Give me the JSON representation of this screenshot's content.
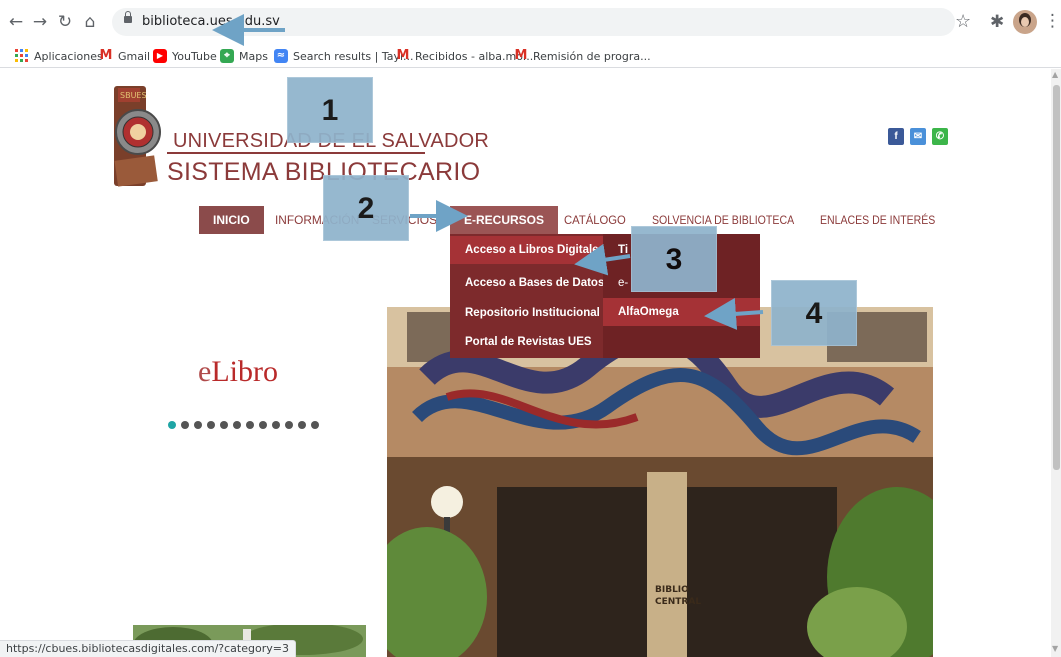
{
  "browser": {
    "url": "biblioteca.ues.edu.sv",
    "bookmarks": [
      {
        "label": "Aplicaciones",
        "icon": "apps-grid-icon"
      },
      {
        "label": "Gmail",
        "icon": "gmail-icon"
      },
      {
        "label": "YouTube",
        "icon": "youtube-icon"
      },
      {
        "label": "Maps",
        "icon": "maps-icon"
      },
      {
        "label": "Search results | Tayl...",
        "icon": "search-results-icon"
      },
      {
        "label": "Recibidos - alba.mo...",
        "icon": "gmail-icon"
      },
      {
        "label": "Remisión de progra...",
        "icon": "gmail-icon"
      }
    ],
    "status_url": "https://cbues.bibliotecasdigitales.com/?category=3"
  },
  "site": {
    "title_line1": "UNIVERSIDAD DE EL SALVADOR",
    "title_line2": "SISTEMA BIBLIOTECARIO",
    "social": [
      {
        "icon": "facebook-icon",
        "glyph": "f",
        "color": "#3b5998"
      },
      {
        "icon": "mail-icon",
        "glyph": "✉",
        "color": "#4a90d9"
      },
      {
        "icon": "phone-icon",
        "glyph": "✆",
        "color": "#3cb54a"
      }
    ],
    "nav": {
      "inicio": "INICIO",
      "informacion": "INFORMACIÓN",
      "servicios": "SERVICIOS",
      "erecursos": "E-RECURSOS",
      "catalogo": "CATÁLOGO",
      "solvencia": "SOLVENCIA DE BIBLIOTECA",
      "enlaces": "ENLACES DE INTERÉS"
    },
    "dropdown": {
      "items": [
        "Acceso a Libros Digitales",
        "Acceso a Bases de Datos",
        "Repositorio Institucional",
        "Portal de Revistas UES"
      ],
      "sub_items": [
        "Ti",
        "e-",
        "AlfaOmega"
      ]
    },
    "slider": {
      "brand_e": "e",
      "brand_rest": "Libro",
      "dot_count": 12,
      "active_dot": 0
    },
    "photo_caption": "BIBLIOTECA CENTRAL"
  },
  "annotations": [
    "1",
    "2",
    "3",
    "4"
  ],
  "colors": {
    "brand": "#8b3a3a",
    "dropdown": "#7d2a2c",
    "dropdown_highlight": "#a53236",
    "callout": "#8fb3cc",
    "arrow": "#6fa3c6"
  }
}
